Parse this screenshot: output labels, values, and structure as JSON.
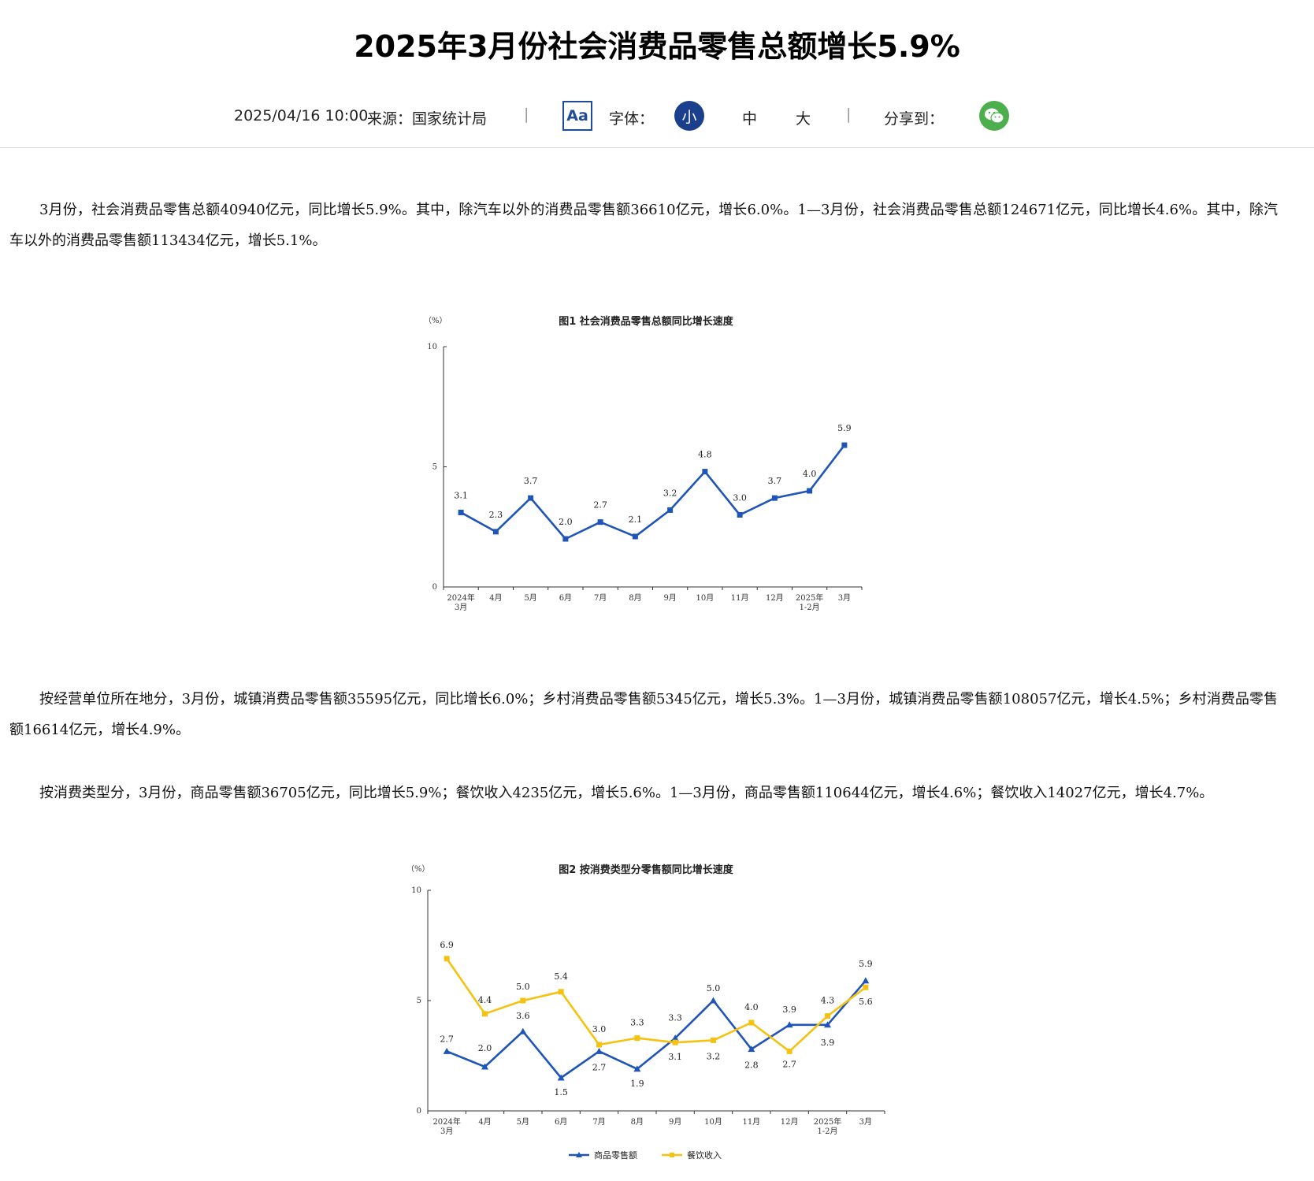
{
  "article": {
    "title": "2025年3月份社会消费品零售总额增长5.9%",
    "date": "2025/04/16 10:00",
    "source": "来源：国家统计局",
    "aa_label": "Aa",
    "font_label": "字体：",
    "font_sizes": [
      "小",
      "中",
      "大"
    ],
    "share_label": "分享到：",
    "separator": "|",
    "paragraphs": [
      "3月份，社会消费品零售总额40940亿元，同比增长5.9%。其中，除汽车以外的消费品零售额36610亿元，增长6.0%。1—3月份，社会消费品零售总额124671亿元，同比增长4.6%。其中，除汽车以外的消费品零售额113434亿元，增长5.1%。",
      "按经营单位所在地分，3月份，城镇消费品零售额35595亿元，同比增长6.0%；乡村消费品零售额5345亿元，增长5.3%。1—3月份，城镇消费品零售额108057亿元，增长4.5%；乡村消费品零售额16614亿元，增长4.9%。",
      "按消费类型分，3月份，商品零售额36705亿元，同比增长5.9%；餐饮收入4235亿元，增长5.6%。1—3月份，商品零售额110644亿元，增长4.6%；餐饮收入14027亿元，增长4.7%。"
    ]
  },
  "colors": {
    "blue": "#1f55b8",
    "yellow": "#f5c211",
    "brand_blue": "#1a3f8c",
    "wechat_green": "#4cae4c"
  },
  "icons": {
    "font": "aa-icon",
    "share": "wechat-icon"
  },
  "chart_data": [
    {
      "type": "line",
      "title": "图1  社会消费品零售总额同比增长速度",
      "ylabel": "（%）",
      "ylim": [
        0,
        10
      ],
      "yticks": [
        "0",
        "5",
        "10"
      ],
      "categories": [
        "2024年|3月",
        "4月",
        "5月",
        "6月",
        "7月",
        "8月",
        "9月",
        "10月",
        "11月",
        "12月",
        "2025年|1-2月",
        "3月"
      ],
      "series": [
        {
          "values": [
            3.1,
            2.3,
            3.7,
            2.0,
            2.7,
            2.1,
            3.2,
            4.8,
            3.0,
            3.7,
            4.0,
            5.9
          ],
          "color": "#1f55b8",
          "marker": "square"
        }
      ],
      "legend": "none"
    },
    {
      "type": "line",
      "title": "图2  按消费类型分零售额同比增长速度",
      "ylabel": "（%）",
      "ylim": [
        0,
        10
      ],
      "yticks": [
        "0",
        "5",
        "10"
      ],
      "categories": [
        "2024年|3月",
        "4月",
        "5月",
        "6月",
        "7月",
        "8月",
        "9月",
        "10月",
        "11月",
        "12月",
        "2025年|1-2月",
        "3月"
      ],
      "series": [
        {
          "name": "商品零售额",
          "values": [
            2.7,
            2.0,
            3.6,
            1.5,
            2.7,
            1.9,
            3.3,
            5.0,
            2.8,
            3.9,
            3.9,
            5.9
          ],
          "color": "#1f55b8",
          "marker": "triangle"
        },
        {
          "name": "餐饮收入",
          "values": [
            6.9,
            4.4,
            5.0,
            5.4,
            3.0,
            3.3,
            3.1,
            3.2,
            4.0,
            2.7,
            4.3,
            5.6
          ],
          "color": "#f5c211",
          "marker": "square"
        }
      ],
      "legend": "bottom"
    }
  ]
}
